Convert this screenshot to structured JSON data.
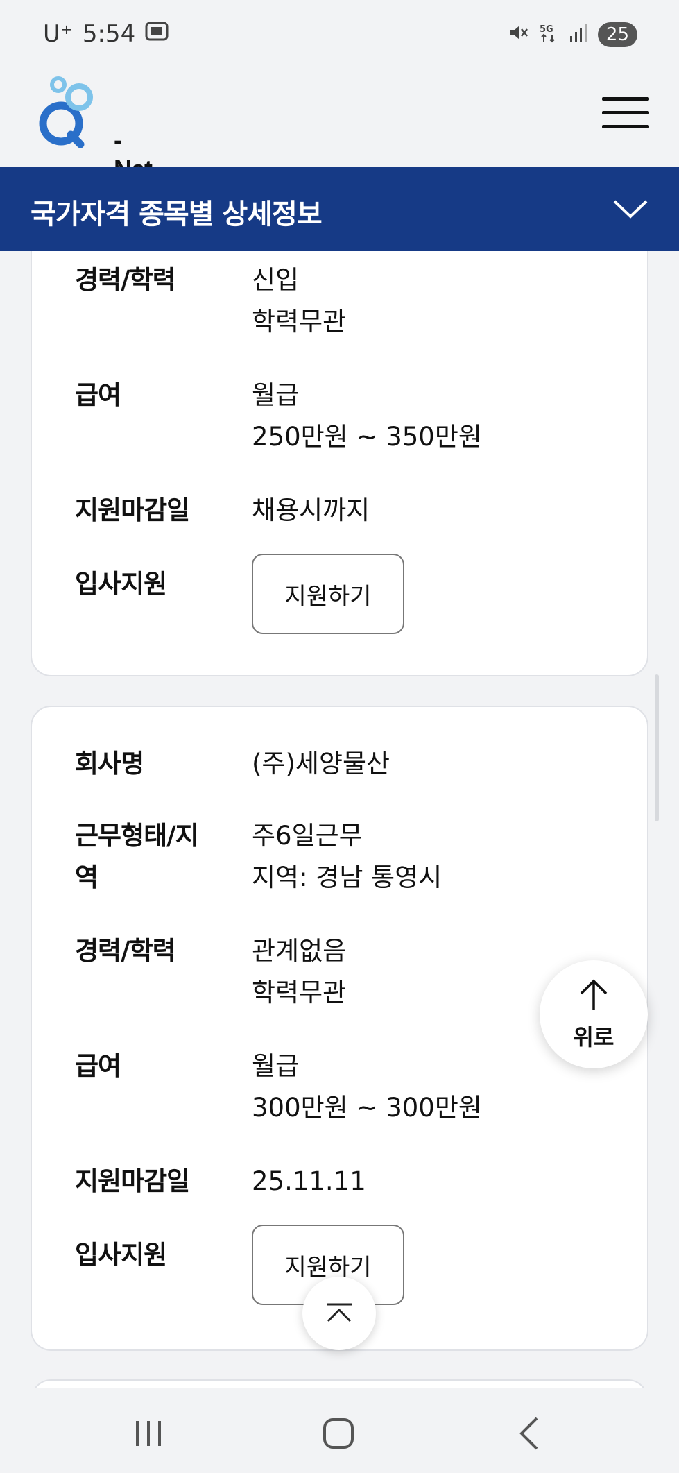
{
  "status_bar": {
    "carrier": "U⁺",
    "time": "5:54",
    "battery": "25"
  },
  "header": {
    "logo_text": "- Net"
  },
  "title_bar": {
    "title": "국가자격 종목별 상세정보"
  },
  "cards": [
    {
      "rows": [
        {
          "label": "경력/학력",
          "lines": [
            "신입",
            "학력무관"
          ]
        },
        {
          "label": "급여",
          "lines": [
            "월급",
            "250만원 ~ 350만원"
          ]
        },
        {
          "label": "지원마감일",
          "lines": [
            "채용시까지"
          ]
        },
        {
          "label": "입사지원",
          "button": "지원하기"
        }
      ]
    },
    {
      "rows": [
        {
          "label": "회사명",
          "lines": [
            "(주)세양물산"
          ]
        },
        {
          "label_lines": [
            "근무형태/지",
            "역"
          ],
          "lines": [
            "주6일근무",
            "지역: 경남 통영시"
          ]
        },
        {
          "label": "경력/학력",
          "lines": [
            "관계없음",
            "학력무관"
          ]
        },
        {
          "label": "급여",
          "lines": [
            "월급",
            "300만원 ~ 300만원"
          ]
        },
        {
          "label": "지원마감일",
          "lines": [
            "25.11.11"
          ]
        },
        {
          "label": "입사지원",
          "button": "지원하기"
        }
      ]
    }
  ],
  "float_up": {
    "label": "위로"
  },
  "colors": {
    "title_bar": "#163a86",
    "logo_blue": "#2a6fc9",
    "logo_light": "#7ec3ea"
  }
}
